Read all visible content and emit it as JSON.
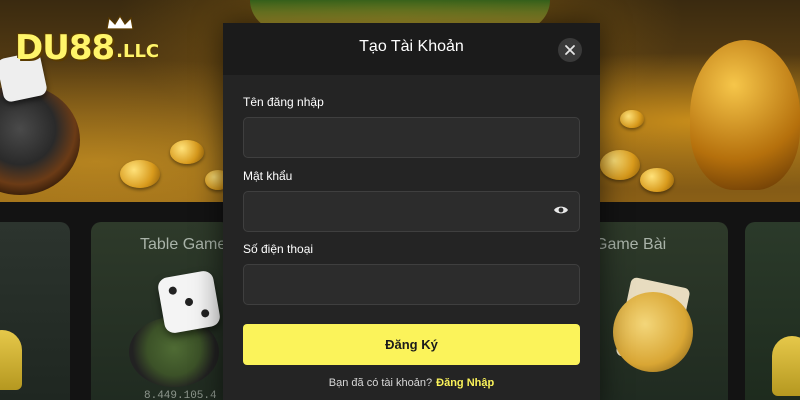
{
  "background": {
    "brand": {
      "name": "DU88",
      "suffix": ".LLC",
      "color": "#fff56a"
    },
    "game_cards": [
      {
        "title": "Table Game",
        "amount": "8.449.105.4"
      },
      {
        "title": "Game Bài"
      }
    ]
  },
  "modal": {
    "title": "Tạo Tài Khoản",
    "close_icon": "close-icon",
    "fields": [
      {
        "label": "Tên đăng nhập",
        "value": "",
        "placeholder": ""
      },
      {
        "label": "Mật khẩu",
        "value": "",
        "placeholder": "",
        "icon": "eye-icon"
      },
      {
        "label": "Số điện thoại",
        "value": "",
        "placeholder": ""
      }
    ],
    "submit_label": "Đăng Ký",
    "footer_prompt": "Bạn đã có tài khoản?",
    "footer_link": "Đăng Nhập",
    "accent_color": "#fbf35a"
  }
}
